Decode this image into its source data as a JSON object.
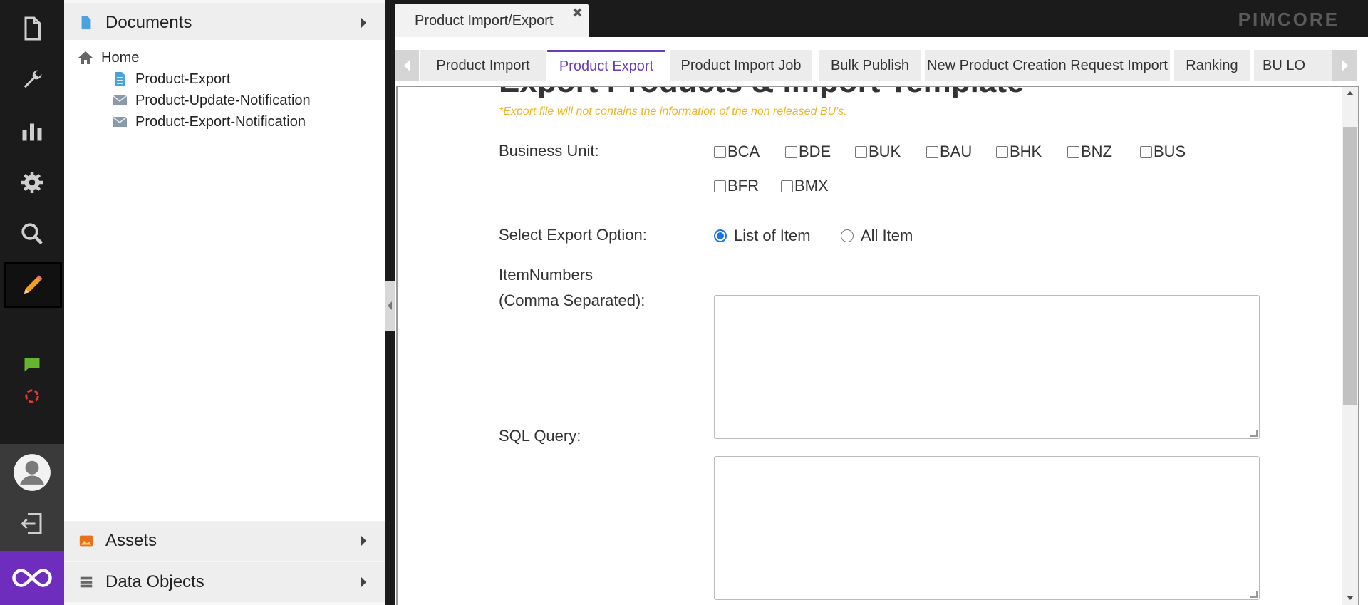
{
  "rail": {
    "icons": [
      "document-icon",
      "wrench-icon",
      "bar-chart-icon",
      "settings-gear-icon",
      "search-icon",
      "pencil-icon",
      "chat-icon",
      "sync-icon",
      "avatar-icon",
      "logout-icon",
      "infinity-logo-icon"
    ],
    "accent_colors": {
      "pencil": "#f0a020",
      "chat": "#65b32e",
      "sync": "#e53935",
      "brand": "#6f2dbd"
    }
  },
  "tree": {
    "documents_label": "Documents",
    "assets_label": "Assets",
    "data_objects_label": "Data Objects",
    "items": [
      {
        "label": "Home",
        "icon": "home-icon"
      },
      {
        "label": "Product-Export",
        "icon": "page-icon"
      },
      {
        "label": "Product-Update-Notification",
        "icon": "email-icon"
      },
      {
        "label": "Product-Export-Notification",
        "icon": "email-icon"
      }
    ]
  },
  "topbar": {
    "tab_label": "Product Import/Export",
    "close_glyph": "✖",
    "logo": "PIMCORE"
  },
  "subtabs": [
    {
      "label": "Product Import",
      "active": false
    },
    {
      "label": "Product Export",
      "active": true
    },
    {
      "label": "Product Import Job",
      "active": false
    },
    {
      "label": "Bulk Publish",
      "active": false
    },
    {
      "label": "New Product Creation Request Import",
      "active": false
    },
    {
      "label": "Ranking",
      "active": false
    },
    {
      "label": "BU LO̶",
      "active": false
    }
  ],
  "form": {
    "heading": "Export Products & Import Template",
    "note": "*Export file will not contains the information of the non released BU's.",
    "business_unit_label": "Business Unit:",
    "business_units": [
      "BCA",
      "BDE",
      "BUK",
      "BAU",
      "BHK",
      "BNZ",
      "BUS",
      "BFR",
      "BMX"
    ],
    "export_option_label": "Select Export Option:",
    "export_options": [
      {
        "label": "List of Item",
        "checked": true
      },
      {
        "label": "All Item",
        "checked": false
      }
    ],
    "item_numbers_label_line1": "ItemNumbers",
    "item_numbers_label_line2": "(Comma Separated):",
    "item_numbers_value": "",
    "sql_query_label": "SQL Query:",
    "sql_query_value": ""
  }
}
